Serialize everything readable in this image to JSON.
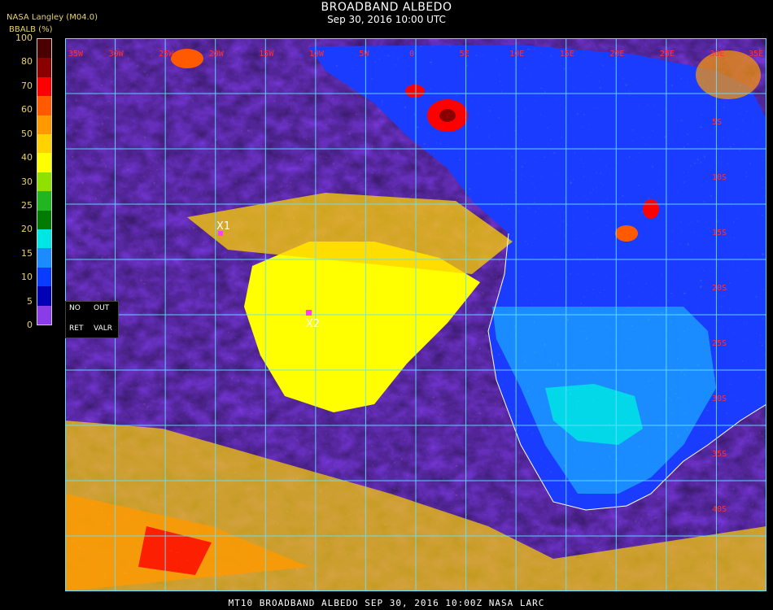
{
  "title": "BROADBAND ALBEDO",
  "subtitle": "Sep 30, 2016 10:00 UTC",
  "producer": "NASA Langley (M04.0)",
  "colorbar": {
    "label": "BBALB (%)",
    "ticks": [
      "100",
      "80",
      "70",
      "60",
      "50",
      "40",
      "30",
      "25",
      "20",
      "15",
      "10",
      "5",
      "0"
    ],
    "colors": [
      "#4a0000",
      "#8a0000",
      "#ff0000",
      "#ff5a00",
      "#ff9900",
      "#ffd200",
      "#ffff00",
      "#90e000",
      "#22b522",
      "#007a00",
      "#00e5e5",
      "#1a8cff",
      "#0a3cff",
      "#0000b4",
      "#8a3ce6"
    ]
  },
  "legend": {
    "no": "NO",
    "out": "OUT",
    "ret": "RET",
    "valr": "VALR"
  },
  "longitude_labels": [
    "35W",
    "30W",
    "25W",
    "20W",
    "15W",
    "10W",
    "5W",
    "0",
    "5E",
    "10E",
    "15E",
    "20E",
    "25E",
    "30E",
    "35E"
  ],
  "latitude_labels": [
    "5S",
    "10S",
    "15S",
    "20S",
    "25S",
    "30S",
    "35S",
    "40S"
  ],
  "markers": [
    {
      "label": "X1"
    },
    {
      "label": "X2"
    }
  ],
  "footer": "MT10   BROADBAND ALBEDO   SEP 30, 2016 10:00Z   NASA LARC"
}
